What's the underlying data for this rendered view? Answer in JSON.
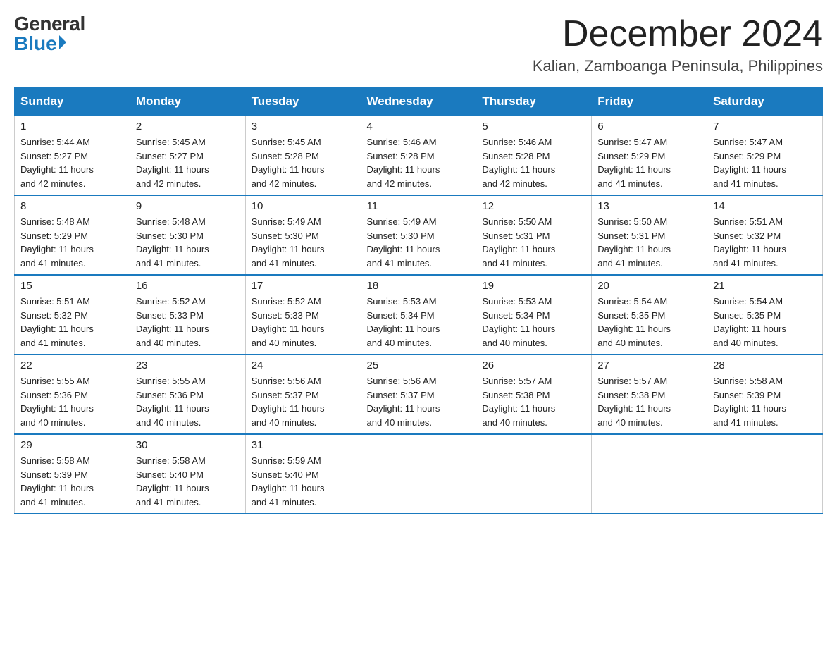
{
  "logo": {
    "general": "General",
    "blue": "Blue"
  },
  "title": "December 2024",
  "location": "Kalian, Zamboanga Peninsula, Philippines",
  "days_of_week": [
    "Sunday",
    "Monday",
    "Tuesday",
    "Wednesday",
    "Thursday",
    "Friday",
    "Saturday"
  ],
  "weeks": [
    [
      {
        "day": "1",
        "sunrise": "5:44 AM",
        "sunset": "5:27 PM",
        "daylight": "11 hours and 42 minutes."
      },
      {
        "day": "2",
        "sunrise": "5:45 AM",
        "sunset": "5:27 PM",
        "daylight": "11 hours and 42 minutes."
      },
      {
        "day": "3",
        "sunrise": "5:45 AM",
        "sunset": "5:28 PM",
        "daylight": "11 hours and 42 minutes."
      },
      {
        "day": "4",
        "sunrise": "5:46 AM",
        "sunset": "5:28 PM",
        "daylight": "11 hours and 42 minutes."
      },
      {
        "day": "5",
        "sunrise": "5:46 AM",
        "sunset": "5:28 PM",
        "daylight": "11 hours and 42 minutes."
      },
      {
        "day": "6",
        "sunrise": "5:47 AM",
        "sunset": "5:29 PM",
        "daylight": "11 hours and 41 minutes."
      },
      {
        "day": "7",
        "sunrise": "5:47 AM",
        "sunset": "5:29 PM",
        "daylight": "11 hours and 41 minutes."
      }
    ],
    [
      {
        "day": "8",
        "sunrise": "5:48 AM",
        "sunset": "5:29 PM",
        "daylight": "11 hours and 41 minutes."
      },
      {
        "day": "9",
        "sunrise": "5:48 AM",
        "sunset": "5:30 PM",
        "daylight": "11 hours and 41 minutes."
      },
      {
        "day": "10",
        "sunrise": "5:49 AM",
        "sunset": "5:30 PM",
        "daylight": "11 hours and 41 minutes."
      },
      {
        "day": "11",
        "sunrise": "5:49 AM",
        "sunset": "5:30 PM",
        "daylight": "11 hours and 41 minutes."
      },
      {
        "day": "12",
        "sunrise": "5:50 AM",
        "sunset": "5:31 PM",
        "daylight": "11 hours and 41 minutes."
      },
      {
        "day": "13",
        "sunrise": "5:50 AM",
        "sunset": "5:31 PM",
        "daylight": "11 hours and 41 minutes."
      },
      {
        "day": "14",
        "sunrise": "5:51 AM",
        "sunset": "5:32 PM",
        "daylight": "11 hours and 41 minutes."
      }
    ],
    [
      {
        "day": "15",
        "sunrise": "5:51 AM",
        "sunset": "5:32 PM",
        "daylight": "11 hours and 41 minutes."
      },
      {
        "day": "16",
        "sunrise": "5:52 AM",
        "sunset": "5:33 PM",
        "daylight": "11 hours and 40 minutes."
      },
      {
        "day": "17",
        "sunrise": "5:52 AM",
        "sunset": "5:33 PM",
        "daylight": "11 hours and 40 minutes."
      },
      {
        "day": "18",
        "sunrise": "5:53 AM",
        "sunset": "5:34 PM",
        "daylight": "11 hours and 40 minutes."
      },
      {
        "day": "19",
        "sunrise": "5:53 AM",
        "sunset": "5:34 PM",
        "daylight": "11 hours and 40 minutes."
      },
      {
        "day": "20",
        "sunrise": "5:54 AM",
        "sunset": "5:35 PM",
        "daylight": "11 hours and 40 minutes."
      },
      {
        "day": "21",
        "sunrise": "5:54 AM",
        "sunset": "5:35 PM",
        "daylight": "11 hours and 40 minutes."
      }
    ],
    [
      {
        "day": "22",
        "sunrise": "5:55 AM",
        "sunset": "5:36 PM",
        "daylight": "11 hours and 40 minutes."
      },
      {
        "day": "23",
        "sunrise": "5:55 AM",
        "sunset": "5:36 PM",
        "daylight": "11 hours and 40 minutes."
      },
      {
        "day": "24",
        "sunrise": "5:56 AM",
        "sunset": "5:37 PM",
        "daylight": "11 hours and 40 minutes."
      },
      {
        "day": "25",
        "sunrise": "5:56 AM",
        "sunset": "5:37 PM",
        "daylight": "11 hours and 40 minutes."
      },
      {
        "day": "26",
        "sunrise": "5:57 AM",
        "sunset": "5:38 PM",
        "daylight": "11 hours and 40 minutes."
      },
      {
        "day": "27",
        "sunrise": "5:57 AM",
        "sunset": "5:38 PM",
        "daylight": "11 hours and 40 minutes."
      },
      {
        "day": "28",
        "sunrise": "5:58 AM",
        "sunset": "5:39 PM",
        "daylight": "11 hours and 41 minutes."
      }
    ],
    [
      {
        "day": "29",
        "sunrise": "5:58 AM",
        "sunset": "5:39 PM",
        "daylight": "11 hours and 41 minutes."
      },
      {
        "day": "30",
        "sunrise": "5:58 AM",
        "sunset": "5:40 PM",
        "daylight": "11 hours and 41 minutes."
      },
      {
        "day": "31",
        "sunrise": "5:59 AM",
        "sunset": "5:40 PM",
        "daylight": "11 hours and 41 minutes."
      },
      null,
      null,
      null,
      null
    ]
  ],
  "labels": {
    "sunrise": "Sunrise:",
    "sunset": "Sunset:",
    "daylight": "Daylight:"
  }
}
